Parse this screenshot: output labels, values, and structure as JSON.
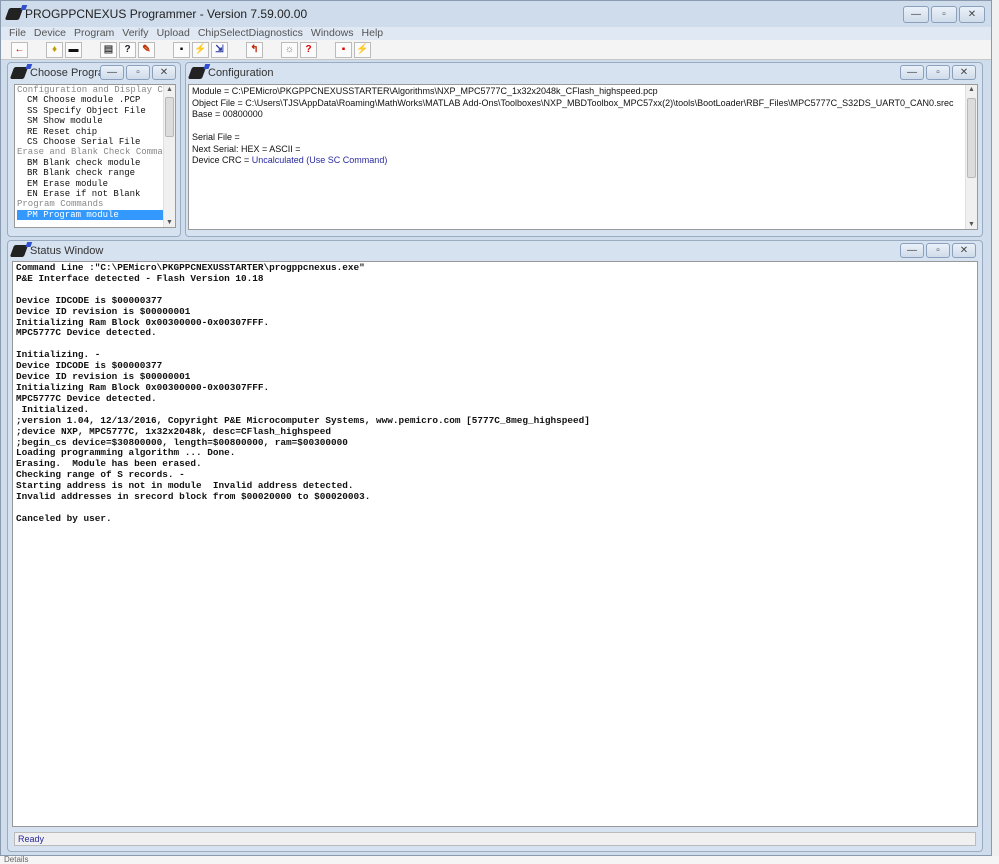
{
  "app": {
    "title": "PROGPPCNEXUS Programmer - Version 7.59.00.00"
  },
  "menu": [
    "File",
    "Device",
    "Program",
    "Verify",
    "Upload",
    "ChipSelectDiagnostics",
    "Windows",
    "Help"
  ],
  "toolbar": [
    {
      "icon": "arrow-left-icon",
      "glyph": "←",
      "color": "#cc0000"
    },
    {
      "icon": "bulb-icon",
      "glyph": "♦",
      "color": "#c0a000"
    },
    {
      "icon": "bar-icon",
      "glyph": "▬",
      "color": "#111"
    },
    {
      "icon": "window-icon",
      "glyph": "▤",
      "color": "#444"
    },
    {
      "icon": "help-window-icon",
      "glyph": "?",
      "color": "#223"
    },
    {
      "icon": "pencil-icon",
      "glyph": "✎",
      "color": "#c03000"
    },
    {
      "icon": "save-icon",
      "glyph": "▪",
      "color": "#111"
    },
    {
      "icon": "program-icon",
      "glyph": "⚡",
      "color": "#b09000"
    },
    {
      "icon": "verify-icon",
      "glyph": "⇲",
      "color": "#2030a0"
    },
    {
      "icon": "upload-icon",
      "glyph": "↰",
      "color": "#c02000"
    },
    {
      "icon": "settings-icon",
      "glyph": "☼",
      "color": "#777"
    },
    {
      "icon": "help-icon",
      "glyph": "?",
      "color": "#dd0000"
    },
    {
      "icon": "red-save-icon",
      "glyph": "▪",
      "color": "#dd0000"
    },
    {
      "icon": "flash-icon",
      "glyph": "⚡",
      "color": "#dd0000"
    }
  ],
  "choose": {
    "title": "Choose Progra...",
    "items": [
      {
        "text": "Configuration and Display Co",
        "type": "hdr"
      },
      {
        "text": "CM Choose module .PCP",
        "type": "it"
      },
      {
        "text": "SS Specify Object File",
        "type": "it"
      },
      {
        "text": "SM Show module",
        "type": "it"
      },
      {
        "text": "RE Reset chip",
        "type": "it"
      },
      {
        "text": "CS Choose Serial File",
        "type": "it"
      },
      {
        "text": "Erase and Blank Check Comman",
        "type": "hdr"
      },
      {
        "text": "BM Blank check module",
        "type": "it"
      },
      {
        "text": "BR Blank check range",
        "type": "it"
      },
      {
        "text": "EM Erase module",
        "type": "it"
      },
      {
        "text": "EN Erase if not Blank",
        "type": "it"
      },
      {
        "text": "Program Commands",
        "type": "hdr"
      },
      {
        "text": "PM Program module",
        "type": "it sel"
      }
    ]
  },
  "config": {
    "title": "Configuration",
    "module": "Module = C:\\PEMicro\\PKGPPCNEXUSSTARTER\\Algorithms\\NXP_MPC5777C_1x32x2048k_CFlash_highspeed.pcp",
    "object": "Object File = C:\\Users\\TJS\\AppData\\Roaming\\MathWorks\\MATLAB Add-Ons\\Toolboxes\\NXP_MBDToolbox_MPC57xx(2)\\tools\\BootLoader\\RBF_Files\\MPC5777C_S32DS_UART0_CAN0.srec",
    "base": "Base = 00800000",
    "serial_file": "Serial File =",
    "next_serial": "Next Serial: HEX =   ASCII =",
    "crc_label": "Device CRC = ",
    "crc_value": "Uncalculated (Use SC Command)"
  },
  "status": {
    "title": "Status Window",
    "log": "Command Line :\"C:\\PEMicro\\PKGPPCNEXUSSTARTER\\progppcnexus.exe\"\nP&E Interface detected - Flash Version 10.18\n\nDevice IDCODE is $00000377\nDevice ID revision is $00000001\nInitializing Ram Block 0x00300000-0x00307FFF.\nMPC5777C Device detected.\n\nInitializing. -\nDevice IDCODE is $00000377\nDevice ID revision is $00000001\nInitializing Ram Block 0x00300000-0x00307FFF.\nMPC5777C Device detected.\n Initialized.\n;version 1.04, 12/13/2016, Copyright P&E Microcomputer Systems, www.pemicro.com [5777C_8meg_highspeed]\n;device NXP, MPC5777C, 1x32x2048k, desc=CFlash_highspeed\n;begin_cs device=$30800000, length=$00800000, ram=$00300000\nLoading programming algorithm ... Done.\nErasing.  Module has been erased.\nChecking range of S records. -\nStarting address is not in module  Invalid address detected.\nInvalid addresses in srecord block from $00020000 to $00020003.\n\nCanceled by user.",
    "ready": "Ready"
  },
  "bottom": {
    "text": "Details"
  },
  "colors": {
    "selection": "#3399ff",
    "crc": "#2a2aa0"
  }
}
